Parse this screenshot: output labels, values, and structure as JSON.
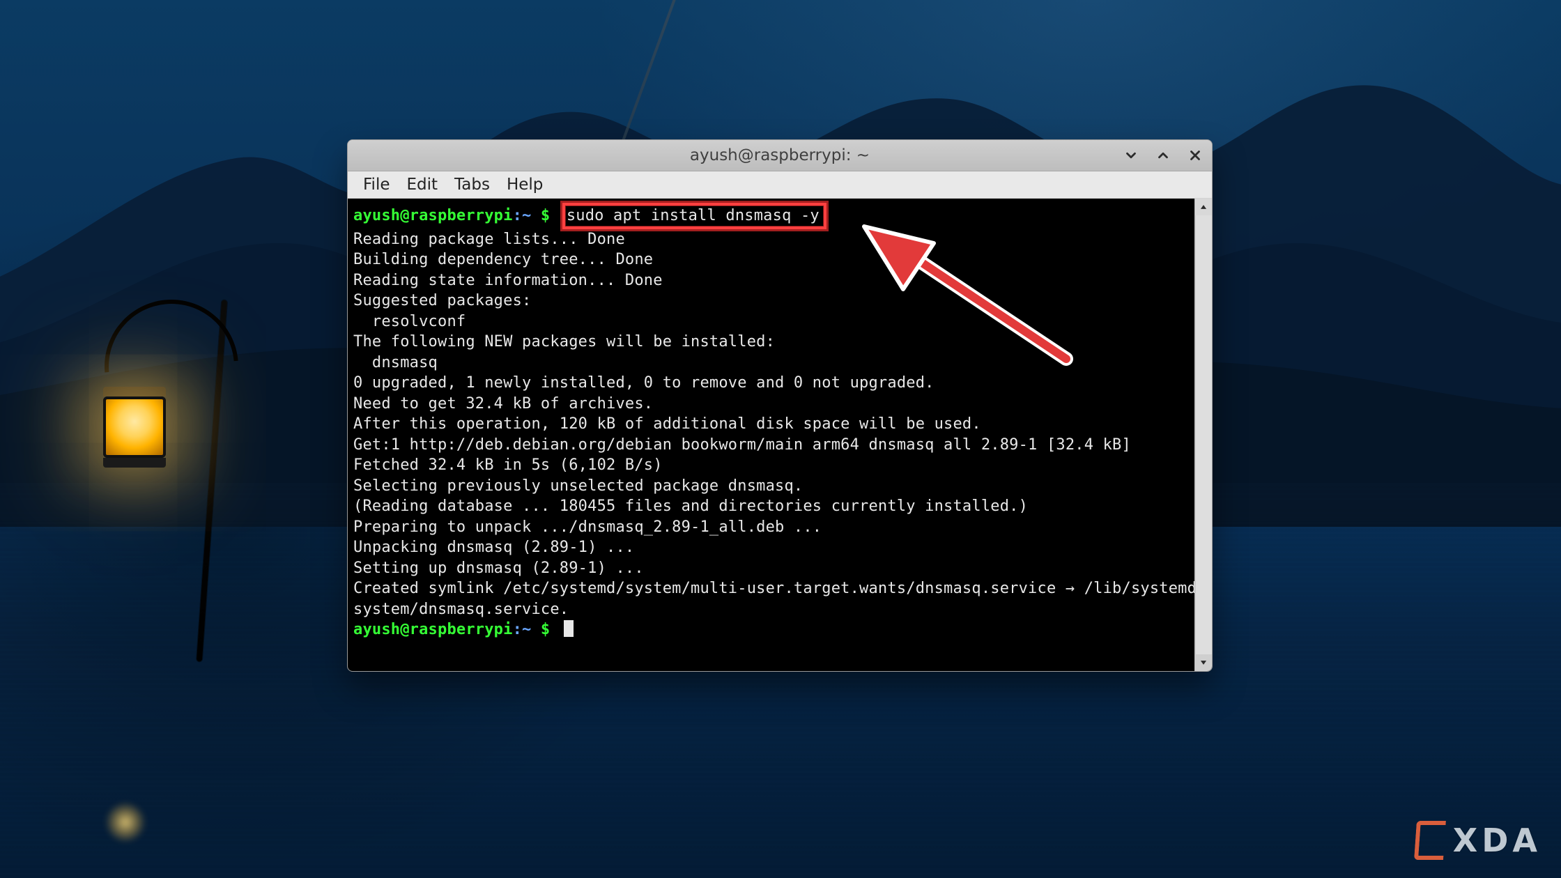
{
  "window": {
    "title": "ayush@raspberrypi: ~",
    "menu": {
      "file": "File",
      "edit": "Edit",
      "tabs": "Tabs",
      "help": "Help"
    }
  },
  "prompt": {
    "user_host": "ayush@raspberrypi",
    "colon": ":",
    "path": "~",
    "dollar": " $ "
  },
  "command": "sudo apt install dnsmasq -y",
  "output": "Reading package lists... Done\nBuilding dependency tree... Done\nReading state information... Done\nSuggested packages:\n  resolvconf\nThe following NEW packages will be installed:\n  dnsmasq\n0 upgraded, 1 newly installed, 0 to remove and 0 not upgraded.\nNeed to get 32.4 kB of archives.\nAfter this operation, 120 kB of additional disk space will be used.\nGet:1 http://deb.debian.org/debian bookworm/main arm64 dnsmasq all 2.89-1 [32.4 kB]\nFetched 32.4 kB in 5s (6,102 B/s)\nSelecting previously unselected package dnsmasq.\n(Reading database ... 180455 files and directories currently installed.)\nPreparing to unpack .../dnsmasq_2.89-1_all.deb ...\nUnpacking dnsmasq (2.89-1) ...\nSetting up dnsmasq (2.89-1) ...\nCreated symlink /etc/systemd/system/multi-user.target.wants/dnsmasq.service → /lib/systemd/system/dnsmasq.service.",
  "watermark": "XDA"
}
